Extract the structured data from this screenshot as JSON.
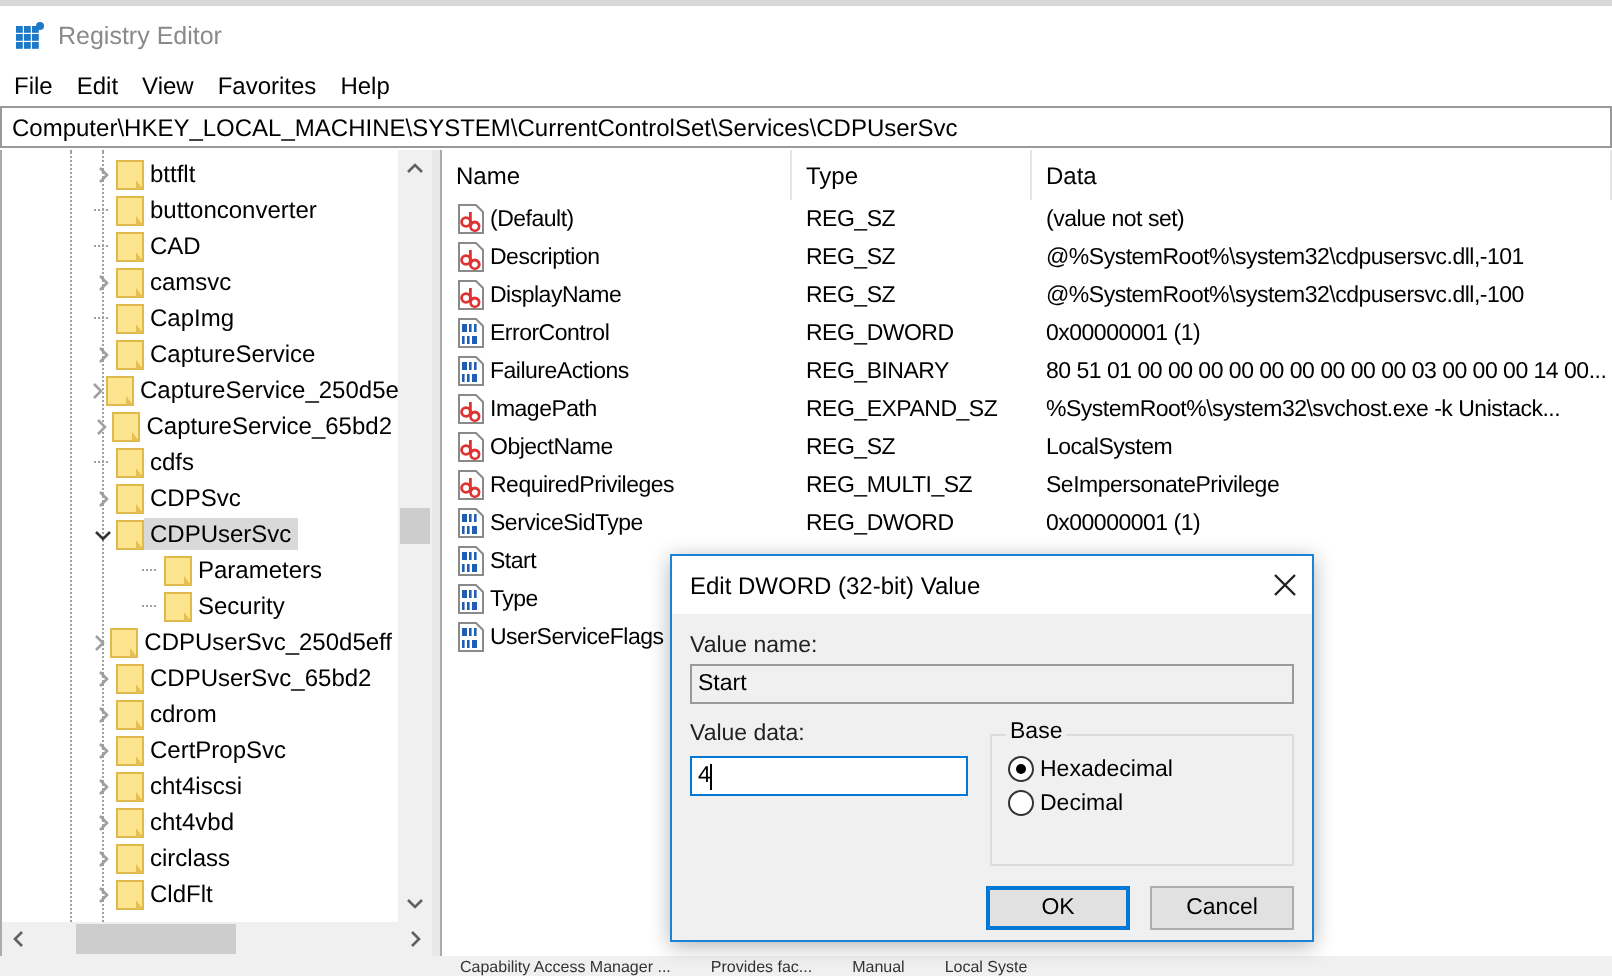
{
  "window": {
    "title": "Registry Editor"
  },
  "menu": [
    "File",
    "Edit",
    "View",
    "Favorites",
    "Help"
  ],
  "address": "Computer\\HKEY_LOCAL_MACHINE\\SYSTEM\\CurrentControlSet\\Services\\CDPUserSvc",
  "tree": [
    {
      "label": "bttflt",
      "kind": "branch",
      "expanded": false,
      "selected": false
    },
    {
      "label": "buttonconverter",
      "kind": "leaf",
      "selected": false
    },
    {
      "label": "CAD",
      "kind": "leaf",
      "selected": false
    },
    {
      "label": "camsvc",
      "kind": "branch",
      "expanded": false,
      "selected": false
    },
    {
      "label": "CapImg",
      "kind": "leaf",
      "selected": false
    },
    {
      "label": "CaptureService",
      "kind": "branch",
      "expanded": false,
      "selected": false
    },
    {
      "label": "CaptureService_250d5e",
      "kind": "branch",
      "expanded": false,
      "selected": false
    },
    {
      "label": "CaptureService_65bd2",
      "kind": "branch",
      "expanded": false,
      "selected": false
    },
    {
      "label": "cdfs",
      "kind": "leaf",
      "selected": false
    },
    {
      "label": "CDPSvc",
      "kind": "branch",
      "expanded": false,
      "selected": false
    },
    {
      "label": "CDPUserSvc",
      "kind": "branch",
      "expanded": true,
      "selected": true,
      "children": [
        {
          "label": "Parameters",
          "kind": "leaf",
          "selected": false
        },
        {
          "label": "Security",
          "kind": "leaf",
          "selected": false
        }
      ]
    },
    {
      "label": "CDPUserSvc_250d5eff",
      "kind": "branch",
      "expanded": false,
      "selected": false
    },
    {
      "label": "CDPUserSvc_65bd2",
      "kind": "branch",
      "expanded": false,
      "selected": false
    },
    {
      "label": "cdrom",
      "kind": "branch",
      "expanded": false,
      "selected": false
    },
    {
      "label": "CertPropSvc",
      "kind": "branch",
      "expanded": false,
      "selected": false
    },
    {
      "label": "cht4iscsi",
      "kind": "branch",
      "expanded": false,
      "selected": false
    },
    {
      "label": "cht4vbd",
      "kind": "branch",
      "expanded": false,
      "selected": false
    },
    {
      "label": "circlass",
      "kind": "branch",
      "expanded": false,
      "selected": false
    },
    {
      "label": "CldFlt",
      "kind": "branch",
      "expanded": false,
      "selected": false
    }
  ],
  "table": {
    "columns": [
      "Name",
      "Type",
      "Data"
    ],
    "rows": [
      {
        "kind": "string",
        "name": "(Default)",
        "type": "REG_SZ",
        "data": "(value not set)"
      },
      {
        "kind": "string",
        "name": "Description",
        "type": "REG_SZ",
        "data": "@%SystemRoot%\\system32\\cdpusersvc.dll,-101"
      },
      {
        "kind": "string",
        "name": "DisplayName",
        "type": "REG_SZ",
        "data": "@%SystemRoot%\\system32\\cdpusersvc.dll,-100"
      },
      {
        "kind": "binary",
        "name": "ErrorControl",
        "type": "REG_DWORD",
        "data": "0x00000001 (1)"
      },
      {
        "kind": "binary",
        "name": "FailureActions",
        "type": "REG_BINARY",
        "data": "80 51 01 00 00 00 00 00 00 00 00 00 03 00 00 00 14 00..."
      },
      {
        "kind": "string",
        "name": "ImagePath",
        "type": "REG_EXPAND_SZ",
        "data": "%SystemRoot%\\system32\\svchost.exe -k Unistack..."
      },
      {
        "kind": "string",
        "name": "ObjectName",
        "type": "REG_SZ",
        "data": "LocalSystem"
      },
      {
        "kind": "string",
        "name": "RequiredPrivileges",
        "type": "REG_MULTI_SZ",
        "data": "SeImpersonatePrivilege"
      },
      {
        "kind": "binary",
        "name": "ServiceSidType",
        "type": "REG_DWORD",
        "data": "0x00000001 (1)"
      },
      {
        "kind": "binary",
        "name": "Start"
      },
      {
        "kind": "binary",
        "name": "Type"
      },
      {
        "kind": "binary",
        "name": "UserServiceFlags"
      }
    ]
  },
  "dialog": {
    "title": "Edit DWORD (32-bit) Value",
    "value_name_label": "Value name:",
    "value_name": "Start",
    "value_data_label": "Value data:",
    "value_data": "4",
    "base_label": "Base",
    "bases": [
      {
        "label": "Hexadecimal",
        "selected": true
      },
      {
        "label": "Decimal",
        "selected": false
      }
    ],
    "buttons": [
      {
        "label": "OK",
        "default": true
      },
      {
        "label": "Cancel",
        "default": false
      }
    ]
  },
  "background_window": [
    "Capability Access Manager ...",
    "Provides fac...",
    "Manual",
    "Local Syste"
  ]
}
